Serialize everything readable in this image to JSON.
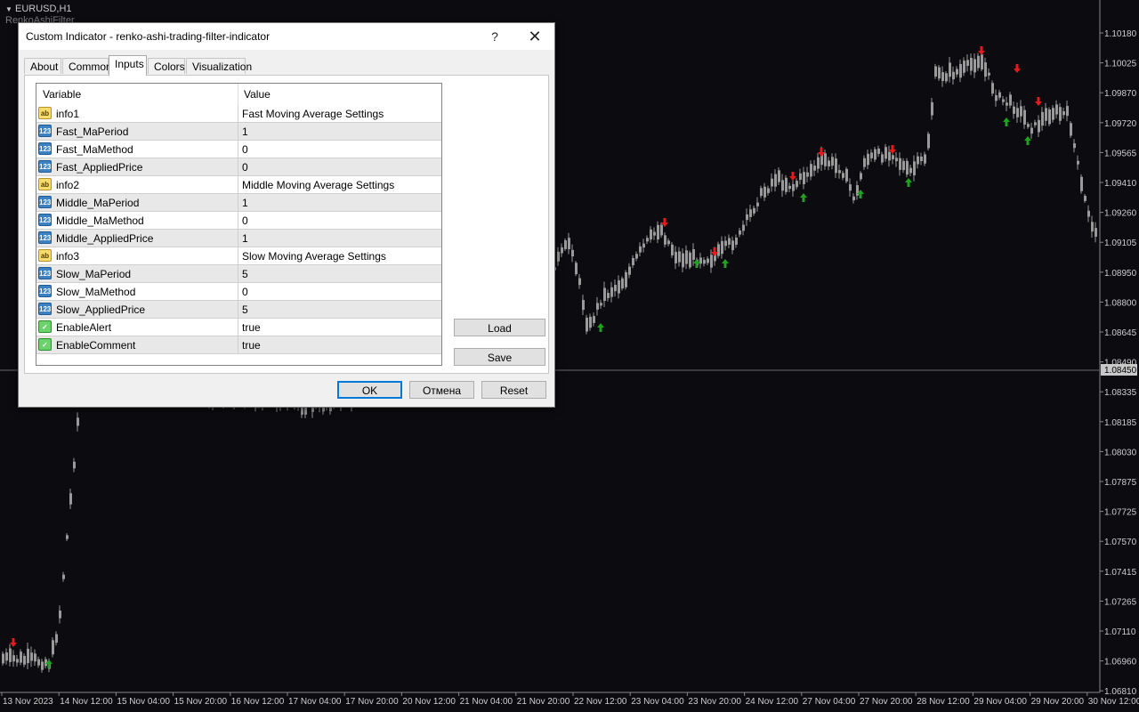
{
  "chart": {
    "symbol_label": "EURUSD,H1",
    "indicator_label": "RenkoAshiFilter",
    "current_price": "1.08450",
    "price_labels": [
      "1.10180",
      "1.10025",
      "1.09870",
      "1.09720",
      "1.09565",
      "1.09410",
      "1.09260",
      "1.09105",
      "1.08950",
      "1.08800",
      "1.08645",
      "1.08490",
      "1.08335",
      "1.08185",
      "1.08030",
      "1.07875",
      "1.07725",
      "1.07570",
      "1.07415",
      "1.07265",
      "1.07110",
      "1.06960",
      "1.06810"
    ],
    "time_labels": [
      "13 Nov 2023",
      "14 Nov 12:00",
      "15 Nov 04:00",
      "15 Nov 20:00",
      "16 Nov 12:00",
      "17 Nov 04:00",
      "17 Nov 20:00",
      "20 Nov 12:00",
      "21 Nov 04:00",
      "21 Nov 20:00",
      "22 Nov 12:00",
      "23 Nov 04:00",
      "23 Nov 20:00",
      "24 Nov 12:00",
      "27 Nov 04:00",
      "27 Nov 20:00",
      "28 Nov 12:00",
      "29 Nov 04:00",
      "29 Nov 20:00",
      "30 Nov 12:00"
    ],
    "colors": {
      "background": "#0b0b10",
      "candle": "#9a9a9a",
      "up_arrow": "#1fa31f",
      "down_arrow": "#e51b1b",
      "grid_line": "#5a5a5a"
    }
  },
  "dialog": {
    "title": "Custom Indicator - renko-ashi-trading-filter-indicator",
    "help_glyph": "?",
    "close_glyph": "✕",
    "tabs": [
      "About",
      "Common",
      "Inputs",
      "Colors",
      "Visualization"
    ],
    "active_tab": "Inputs",
    "columns": {
      "variable": "Variable",
      "value": "Value"
    },
    "rows": [
      {
        "icon": "ab",
        "name": "info1",
        "value": "Fast Moving Average Settings"
      },
      {
        "icon": "123",
        "name": "Fast_MaPeriod",
        "value": "1"
      },
      {
        "icon": "123",
        "name": "Fast_MaMethod",
        "value": "0"
      },
      {
        "icon": "123",
        "name": "Fast_AppliedPrice",
        "value": "0"
      },
      {
        "icon": "ab",
        "name": "info2",
        "value": "Middle  Moving Average Settings"
      },
      {
        "icon": "123",
        "name": "Middle_MaPeriod",
        "value": "1"
      },
      {
        "icon": "123",
        "name": "Middle_MaMethod",
        "value": "0"
      },
      {
        "icon": "123",
        "name": "Middle_AppliedPrice",
        "value": "1"
      },
      {
        "icon": "ab",
        "name": "info3",
        "value": "Slow Moving Average Settings"
      },
      {
        "icon": "123",
        "name": "Slow_MaPeriod",
        "value": "5"
      },
      {
        "icon": "123",
        "name": "Slow_MaMethod",
        "value": "0"
      },
      {
        "icon": "123",
        "name": "Slow_AppliedPrice",
        "value": "5"
      },
      {
        "icon": "bool",
        "name": "EnableAlert",
        "value": "true"
      },
      {
        "icon": "bool",
        "name": "EnableComment",
        "value": "true"
      }
    ],
    "buttons": {
      "load": "Load",
      "save": "Save",
      "ok": "OK",
      "cancel": "Отмена",
      "reset": "Reset"
    }
  }
}
